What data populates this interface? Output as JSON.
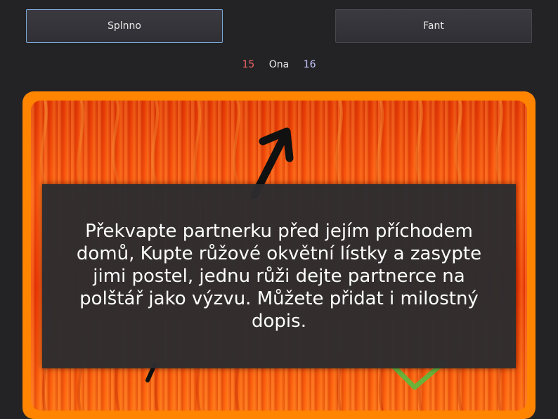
{
  "buttons": {
    "done_label": "Splnno",
    "forfeit_label": "Fant"
  },
  "score": {
    "left_value": "15",
    "player_name": "Ona",
    "right_value": "16"
  },
  "task": {
    "text": "Překvapte partnerku před jejím příchodem domů, Kupte růžové okvětní lístky a zasypte jimi postel, jednu růži dejte partnerce na polštář jako výzvu. Můžete přidat i milostný dopis."
  },
  "colors": {
    "background": "#232326",
    "card_frame": "#ff8400",
    "fire": "#f43c06",
    "score_left": "#f06464",
    "score_right": "#c6c8ff",
    "selected_border": "#7aa7d8"
  },
  "icons": {
    "arrow": "arrow-up-right-icon",
    "check": "checkmark-icon",
    "cross": "cross-icon"
  }
}
